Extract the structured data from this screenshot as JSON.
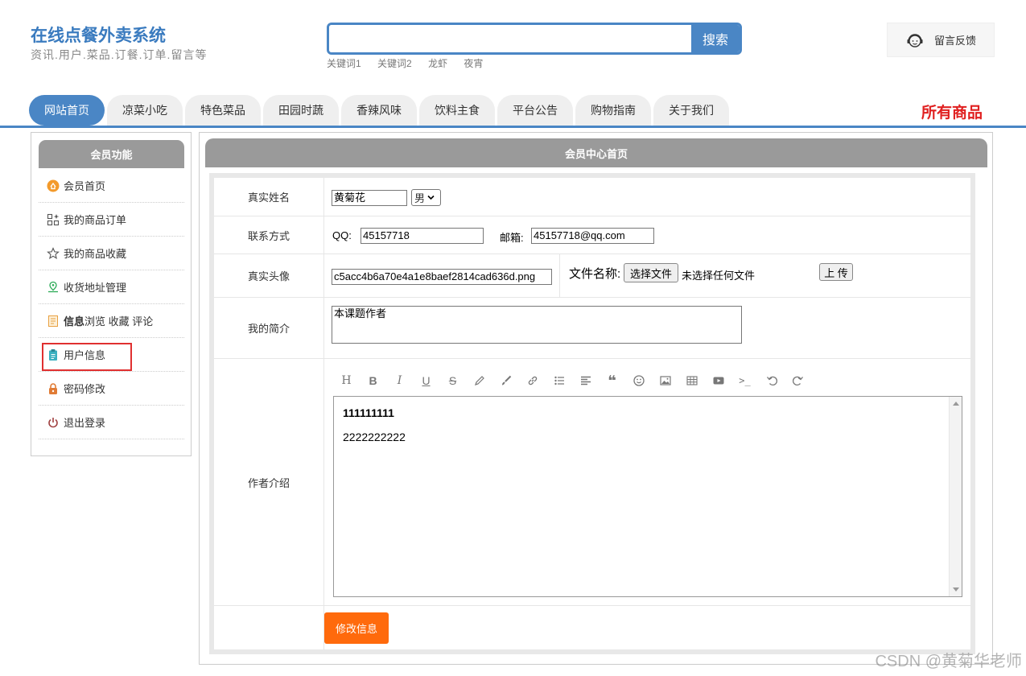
{
  "header": {
    "title": "在线点餐外卖系统",
    "subtitle": "资讯.用户.菜品.订餐.订单.留言等",
    "search": {
      "placeholder": "",
      "button": "搜索"
    },
    "keywords": [
      "关键词1",
      "关键词2",
      "龙虾",
      "夜宵"
    ],
    "feedback": "留言反馈"
  },
  "nav": {
    "items": [
      "网站首页",
      "凉菜小吃",
      "特色菜品",
      "田园时蔬",
      "香辣风味",
      "饮料主食",
      "平台公告",
      "购物指南",
      "关于我们"
    ],
    "active_index": 0,
    "all_goods": "所有商品"
  },
  "sidebar": {
    "title": "会员功能",
    "items": [
      {
        "label": "会员首页",
        "icon": "member-home-icon"
      },
      {
        "label": "我的商品订单",
        "icon": "orders-icon"
      },
      {
        "label": "我的商品收藏",
        "icon": "star-icon"
      },
      {
        "label": "收货地址管理",
        "icon": "location-icon"
      },
      {
        "label_bold": "信息",
        "label": " 浏览 收藏 评论",
        "icon": "document-icon"
      },
      {
        "label": "用户信息",
        "icon": "clipboard-icon",
        "highlighted": true
      },
      {
        "label": "密码修改",
        "icon": "lock-icon"
      },
      {
        "label": "退出登录",
        "icon": "power-icon"
      }
    ]
  },
  "main": {
    "title": "会员中心首页",
    "form": {
      "name_label": "真实姓名",
      "name_value": "黄菊花",
      "gender_value": "男",
      "contact_label": "联系方式",
      "qq_label": "QQ:",
      "qq_value": "45157718",
      "email_label": "邮箱:",
      "email_value": "45157718@qq.com",
      "avatar_label": "真实头像",
      "avatar_value": "c5acc4b6a70e4a1e8baef2814cad636d.png",
      "file_name_label": "文件名称:",
      "choose_file_button": "选择文件",
      "no_file_text": "未选择任何文件",
      "upload_button": "上 传",
      "bio_label": "我的简介",
      "bio_value": "本课题作者",
      "author_label": "作者介绍",
      "editor_line1": "111111111",
      "editor_line2": "2222222222",
      "submit_button": "修改信息"
    },
    "toolbar_icons": [
      "heading-icon",
      "bold-icon",
      "italic-icon",
      "underline-icon",
      "strikethrough-icon",
      "pen-icon",
      "brush-icon",
      "link-icon",
      "list-icon",
      "align-icon",
      "quote-icon",
      "emoji-icon",
      "image-icon",
      "table-icon",
      "video-icon",
      "code-icon",
      "undo-icon",
      "redo-icon"
    ]
  },
  "watermark": "CSDN @黄菊华老师",
  "colors": {
    "primary": "#4a86c5",
    "accent_red": "#e02020",
    "submit_orange": "#ff6a0c",
    "panel_header": "#9a9a9a"
  }
}
